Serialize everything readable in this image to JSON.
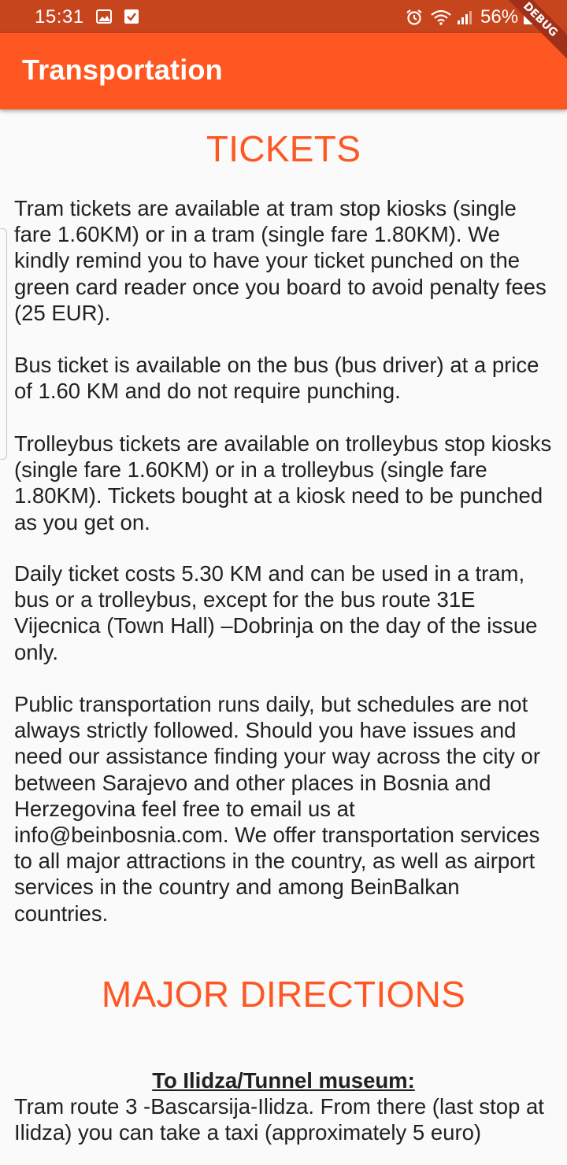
{
  "status_bar": {
    "time": "15:31",
    "battery": "56%",
    "icons": [
      "image-icon",
      "check-box-icon",
      "alarm-icon",
      "wifi-icon",
      "signal-icon",
      "battery-icon"
    ]
  },
  "app_bar": {
    "title": "Transportation",
    "color": "#ff5722",
    "debug_label": "DEBUG"
  },
  "tickets": {
    "heading": "TICKETS",
    "paragraphs": [
      "Tram tickets are available at tram stop kiosks (single fare 1.60KM) or in a tram (single fare 1.80KM). We kindly remind you to have your ticket punched on the green card reader once you board to avoid penalty fees (25 EUR).",
      "Bus ticket is available on the bus (bus driver) at a price of 1.60 KM and do not require punching.",
      "Trolleybus tickets are available on trolleybus stop kiosks (single fare 1.60KM) or in a trolleybus (single fare 1.80KM). Tickets bought at a kiosk need to be punched as you get on.",
      "Daily ticket costs 5.30 KM and can be used in a tram, bus or a trolleybus, except for the bus route 31E Vijecnica (Town Hall) –Dobrinja on the day of the issue only.",
      "Public transportation runs daily, but schedules are not always strictly followed. Should you have issues and need our assistance finding your way across the city or between Sarajevo and other places in Bosnia and Herzegovina feel free to email us at info@beinbosnia.com. We offer transportation services to all major attractions in the country, as well as airport services in the country and among BeinBalkan countries."
    ]
  },
  "major_directions": {
    "heading": "MAJOR DIRECTIONS",
    "subheading": "To Ilidza/Tunnel museum: ",
    "paragraph": "Tram route 3 -Bascarsija-Ilidza. From there (last stop at Ilidza) you can take a taxi (approximately 5 euro)"
  }
}
